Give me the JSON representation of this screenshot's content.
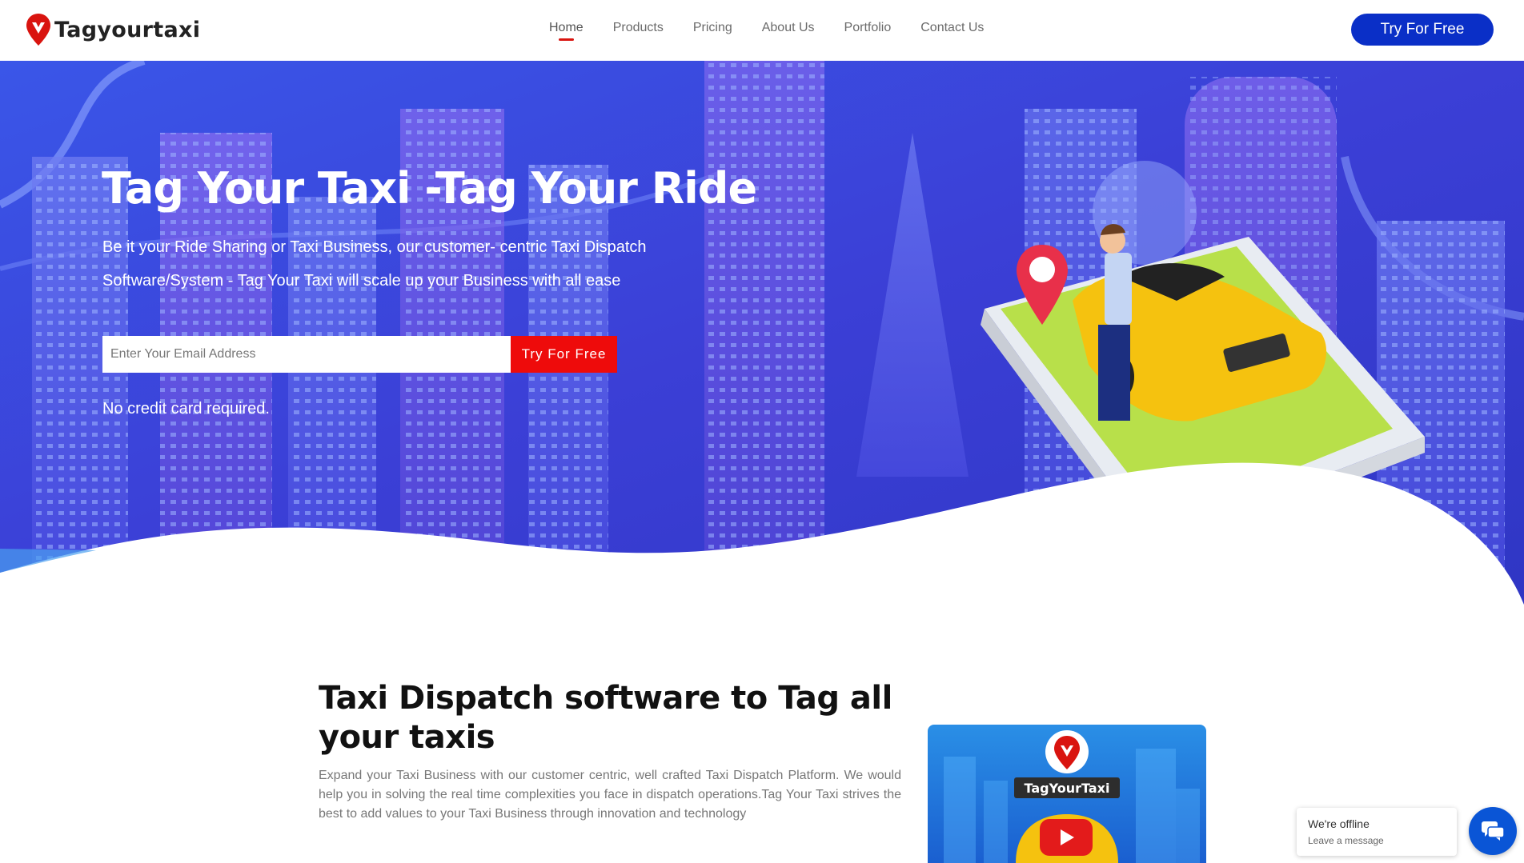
{
  "brand": {
    "name": "Tagyourtaxi",
    "accent": "#d9140f",
    "primary": "#0a2fc7"
  },
  "nav": {
    "items": [
      {
        "label": "Home",
        "active": true
      },
      {
        "label": "Products",
        "active": false
      },
      {
        "label": "Pricing",
        "active": false
      },
      {
        "label": "About Us",
        "active": false
      },
      {
        "label": "Portfolio",
        "active": false
      },
      {
        "label": "Contact Us",
        "active": false
      }
    ],
    "cta_label": "Try For Free"
  },
  "hero": {
    "title": "Tag Your Taxi -Tag Your Ride",
    "subtitle": "Be it your Ride Sharing or Taxi Business, our customer- centric Taxi Dispatch Software/System - Tag Your Taxi will scale up your Business with all ease",
    "email_placeholder": "Enter Your Email Address",
    "email_value": "",
    "cta_label": "Try For Free",
    "note": "No credit card required."
  },
  "section": {
    "title": "Taxi Dispatch software to Tag all your taxis",
    "text": "Expand your Taxi Business with our customer centric, well crafted Taxi Dispatch Platform. We would help you in solving the real time complexities you face in dispatch operations.Tag Your Taxi strives the best to add values to your Taxi Business through innovation and technology",
    "video_label": "TagYourTaxi"
  },
  "chat": {
    "title": "We're offline",
    "subtitle": "Leave a message"
  },
  "icons": [
    "logo-pin-icon",
    "play-icon",
    "chat-icon"
  ]
}
